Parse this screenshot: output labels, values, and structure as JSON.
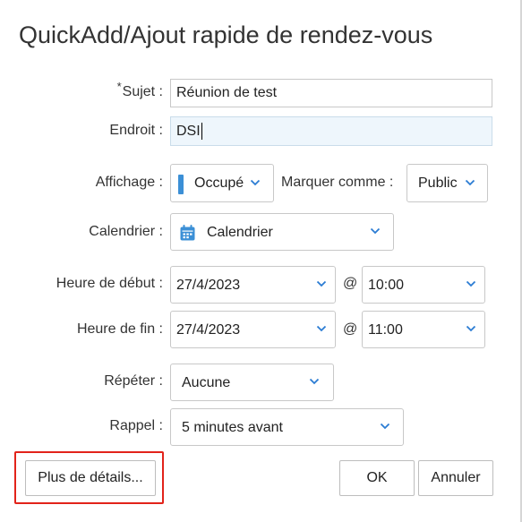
{
  "dialog": {
    "title": "QuickAdd/Ajout rapide de rendez-vous"
  },
  "form": {
    "subject": {
      "required_mark": "*",
      "label": "Sujet :",
      "value": "Réunion de test"
    },
    "location": {
      "label": "Endroit :",
      "value": "DSI"
    },
    "showas": {
      "label": "Affichage :",
      "value": "Occupé",
      "color": "#3b8fd6"
    },
    "markas": {
      "label": "Marquer comme :",
      "value": "Public"
    },
    "calendar": {
      "label": "Calendrier :",
      "value": "Calendrier"
    },
    "start": {
      "label": "Heure de début :",
      "date": "27/4/2023",
      "at": "@",
      "time": "10:00"
    },
    "end": {
      "label": "Heure de fin :",
      "date": "27/4/2023",
      "at": "@",
      "time": "11:00"
    },
    "repeat": {
      "label": "Répéter :",
      "value": "Aucune"
    },
    "reminder": {
      "label": "Rappel :",
      "value": "5 minutes avant"
    }
  },
  "buttons": {
    "more_details": "Plus de détails...",
    "ok": "OK",
    "cancel": "Annuler"
  },
  "colors": {
    "accent": "#2b7cd3",
    "highlight": "#e2231a",
    "active_field": "#eef6fc"
  }
}
